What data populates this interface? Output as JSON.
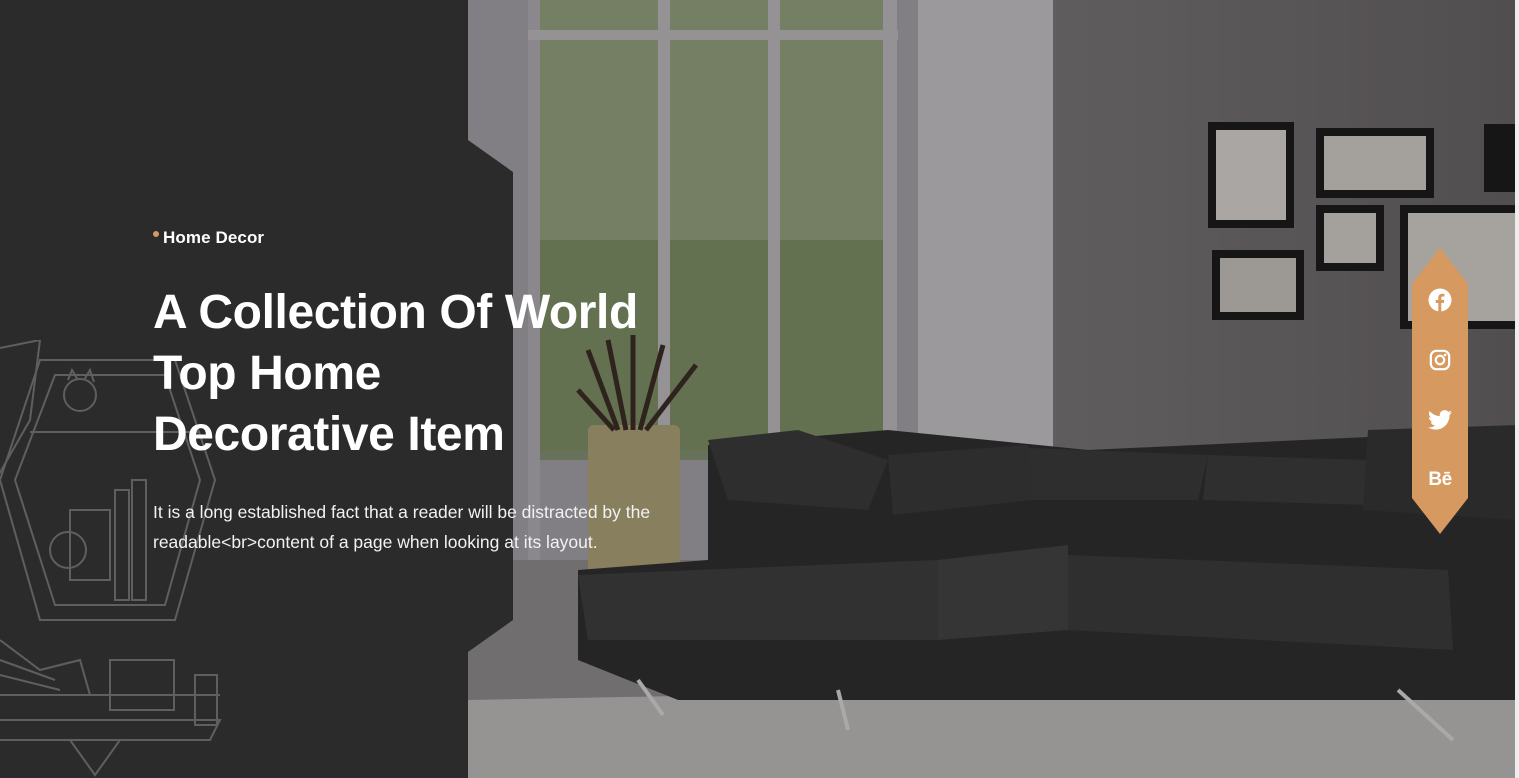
{
  "hero": {
    "eyebrow": "Home Decor",
    "headline_line1": "A Collection Of World",
    "headline_line2": "Top Home",
    "headline_line3": "Decorative Item",
    "description": "It is a long established fact that a reader will be distracted by the readable<br>content of a page when looking at its layout."
  },
  "social": {
    "items": [
      {
        "icon": "facebook-icon",
        "label": "Facebook"
      },
      {
        "icon": "instagram-icon",
        "label": "Instagram"
      },
      {
        "icon": "twitter-icon",
        "label": "Twitter"
      },
      {
        "icon": "behance-icon",
        "label": "Bē"
      }
    ]
  },
  "colors": {
    "panel": "#2b2b2b",
    "accent": "#d69960",
    "text": "#ffffff"
  }
}
